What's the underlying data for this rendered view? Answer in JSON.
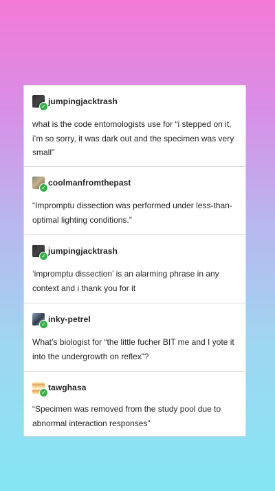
{
  "posts": [
    {
      "username": "jumpingjacktrash",
      "avatar_icon": "jumpingjacktrash-avatar",
      "text": "what is the code entomologists use for “i stepped on it, i’m so sorry, it was dark out and the specimen was very small”"
    },
    {
      "username": "coolmanfromthepast",
      "avatar_icon": "coolmanfromthepast-avatar",
      "text": "“Impromptu dissection was performed under less-than-optimal lighting conditions.”"
    },
    {
      "username": "jumpingjacktrash",
      "avatar_icon": "jumpingjacktrash-avatar",
      "text": "‘impromptu dissection’ is an alarming phrase in any context and i thank you for it"
    },
    {
      "username": "inky-petrel",
      "avatar_icon": "inky-petrel-avatar",
      "text": "What’s biologist for “the little fucher BIT me and I yote it into the undergrowth on reflex”?"
    },
    {
      "username": "tawghasa",
      "avatar_icon": "tawghasa-avatar",
      "text": "“Specimen was removed from the study pool due to abnormal interaction responses”"
    }
  ],
  "colors": {
    "badge": "#36b24a",
    "gradient_top": "#f37ad6",
    "gradient_bottom": "#84e6f3"
  }
}
